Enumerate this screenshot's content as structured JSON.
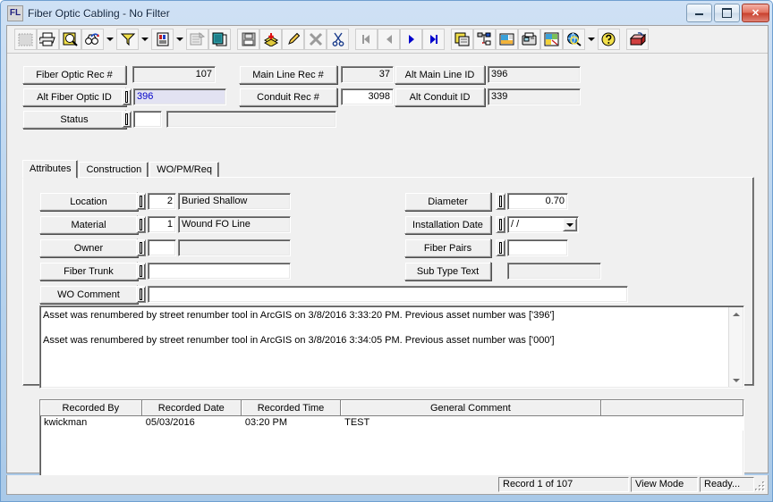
{
  "window": {
    "title": "Fiber Optic Cabling - No Filter",
    "icon_text": "FL",
    "minimize_label": "Minimize",
    "maximize_label": "Maximize",
    "close_label": "✕"
  },
  "colors": {
    "titlebar_start": "#cfe1f5",
    "titlebar_end": "#a9c9e8",
    "face": "#f0f0f0",
    "focus_field_bg": "#e2e2f2",
    "focus_field_text": "#0000c8",
    "close_button": "#c8402d"
  },
  "toolbar": {
    "buttons": [
      {
        "name": "select-all-icon",
        "title": "Select"
      },
      {
        "name": "print-icon",
        "title": "Print"
      },
      {
        "name": "print-preview-icon",
        "title": "Print Preview"
      },
      {
        "name": "find-icon",
        "title": "Find"
      },
      {
        "name": "find-dropdown-icon",
        "title": "Find Options"
      },
      {
        "name": "filter-icon",
        "title": "Filter"
      },
      {
        "name": "filter-dropdown-icon",
        "title": "Filter Options"
      },
      {
        "name": "report-icon",
        "title": "Report"
      },
      {
        "name": "report-dropdown-icon",
        "title": "Report Options"
      },
      {
        "name": "properties-icon",
        "title": "Properties"
      },
      {
        "name": "copy-record-icon",
        "title": "Copy Record"
      },
      {
        "name": "save-icon",
        "title": "Save"
      },
      {
        "name": "add-record-icon",
        "title": "Add Record"
      },
      {
        "name": "edit-icon",
        "title": "Edit"
      },
      {
        "name": "delete-icon",
        "title": "Delete"
      },
      {
        "name": "cut-icon",
        "title": "Cut"
      },
      {
        "name": "first-record-icon",
        "title": "First Record"
      },
      {
        "name": "previous-record-icon",
        "title": "Previous Record"
      },
      {
        "name": "next-record-icon",
        "title": "Next Record"
      },
      {
        "name": "last-record-icon",
        "title": "Last Record"
      },
      {
        "name": "layout-icon",
        "title": "Layout"
      },
      {
        "name": "hierarchy-icon",
        "title": "Hierarchy"
      },
      {
        "name": "image-icon",
        "title": "Images"
      },
      {
        "name": "fax-icon",
        "title": "Fax"
      },
      {
        "name": "map-icon",
        "title": "Map"
      },
      {
        "name": "globe-search-icon",
        "title": "GIS Search"
      },
      {
        "name": "globe-dropdown-icon",
        "title": "GIS Options"
      },
      {
        "name": "help-icon",
        "title": "Help"
      },
      {
        "name": "exit-icon",
        "title": "Exit"
      }
    ]
  },
  "header": {
    "fiber_optic_rec_label": "Fiber Optic Rec #",
    "fiber_optic_rec_value": "107",
    "alt_fiber_optic_id_label": "Alt Fiber Optic ID",
    "alt_fiber_optic_id_value": "396",
    "status_label": "Status",
    "status_code": "",
    "status_desc": "",
    "main_line_rec_label": "Main Line Rec #",
    "main_line_rec_value": "37",
    "conduit_rec_label": "Conduit Rec #",
    "conduit_rec_value": "3098",
    "alt_main_line_id_label": "Alt Main Line ID",
    "alt_main_line_id_value": "396",
    "alt_conduit_id_label": "Alt Conduit ID",
    "alt_conduit_id_value": "339"
  },
  "tabs": [
    {
      "label": "Attributes",
      "active": true
    },
    {
      "label": "Construction",
      "active": false
    },
    {
      "label": "WO/PM/Req",
      "active": false
    }
  ],
  "attributes": {
    "left": [
      {
        "label": "Location",
        "code": "2",
        "desc": "Buried Shallow"
      },
      {
        "label": "Material",
        "code": "1",
        "desc": "Wound FO Line"
      },
      {
        "label": "Owner",
        "code": "",
        "desc": ""
      }
    ],
    "fiber_trunk_label": "Fiber Trunk",
    "fiber_trunk_value": "",
    "wo_comment_label": "WO Comment",
    "wo_comment_value": "",
    "right": {
      "diameter_label": "Diameter",
      "diameter_value": "0.70",
      "installation_date_label": "Installation Date",
      "installation_date_value": "  /  /",
      "fiber_pairs_label": "Fiber Pairs",
      "fiber_pairs_value": "",
      "sub_type_text_label": "Sub Type Text",
      "sub_type_text_value": ""
    }
  },
  "memo": {
    "lines": [
      "Asset was renumbered by street renumber tool in ArcGIS on 3/8/2016 3:33:20 PM.  Previous asset number was ['396']",
      "Asset was renumbered by street renumber tool in ArcGIS on 3/8/2016 3:34:05 PM.  Previous asset number was ['000']"
    ]
  },
  "grid": {
    "columns": [
      "Recorded By",
      "Recorded Date",
      "Recorded Time",
      "General Comment",
      ""
    ],
    "rows": [
      [
        "kwickman",
        "05/03/2016",
        "03:20 PM",
        "TEST",
        ""
      ]
    ]
  },
  "statusbar": {
    "record": "Record 1 of 107",
    "mode": "View Mode",
    "state": "Ready..."
  }
}
